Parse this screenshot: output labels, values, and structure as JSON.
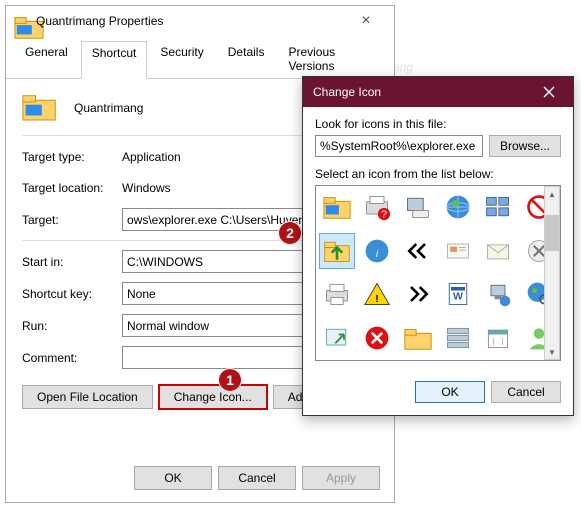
{
  "propWindow": {
    "title": "Quantrimang Properties",
    "tabs": [
      "General",
      "Shortcut",
      "Security",
      "Details",
      "Previous Versions"
    ],
    "activeTab": 1,
    "itemName": "Quantrimang",
    "targetTypeLabel": "Target type:",
    "targetTypeValue": "Application",
    "targetLocationLabel": "Target location:",
    "targetLocationValue": "Windows",
    "targetLabel": "Target:",
    "targetValue": "ows\\explorer.exe C:\\Users\\HuyenSP\\",
    "startInLabel": "Start in:",
    "startInValue": "C:\\WINDOWS",
    "shortcutKeyLabel": "Shortcut key:",
    "shortcutKeyValue": "None",
    "runLabel": "Run:",
    "runValue": "Normal window",
    "commentLabel": "Comment:",
    "commentValue": "",
    "openFileLocation": "Open File Location",
    "changeIcon": "Change Icon...",
    "advanced": "Adv",
    "ok": "OK",
    "cancel": "Cancel",
    "apply": "Apply"
  },
  "iconDialog": {
    "title": "Change Icon",
    "lookForLabel": "Look for icons in this file:",
    "filePath": "%SystemRoot%\\explorer.exe",
    "browse": "Browse...",
    "selectLabel": "Select an icon from the list below:",
    "ok": "OK",
    "cancel": "Cancel",
    "icons": [
      "folder-icon",
      "printer-question-icon",
      "computer-fax-icon",
      "globe-net-icon",
      "thumbnails-icon",
      "no-entry-icon",
      "folder-up-icon",
      "info-icon",
      "chevrons-left-icon",
      "mail-card-icon",
      "envelope-icon",
      "delete-x-icon",
      "printer-icon",
      "warning-icon",
      "chevrons-right-icon",
      "word-doc-icon",
      "computer-net-icon",
      "globe-search-icon",
      "window-arrow-icon",
      "error-x-icon",
      "folder-plain-icon",
      "list-thumb-icon",
      "calendar-icon",
      "user-green-icon"
    ],
    "selectedIconIndex": 6
  },
  "badges": {
    "one": "1",
    "two": "2"
  },
  "watermark": "uantrimang"
}
